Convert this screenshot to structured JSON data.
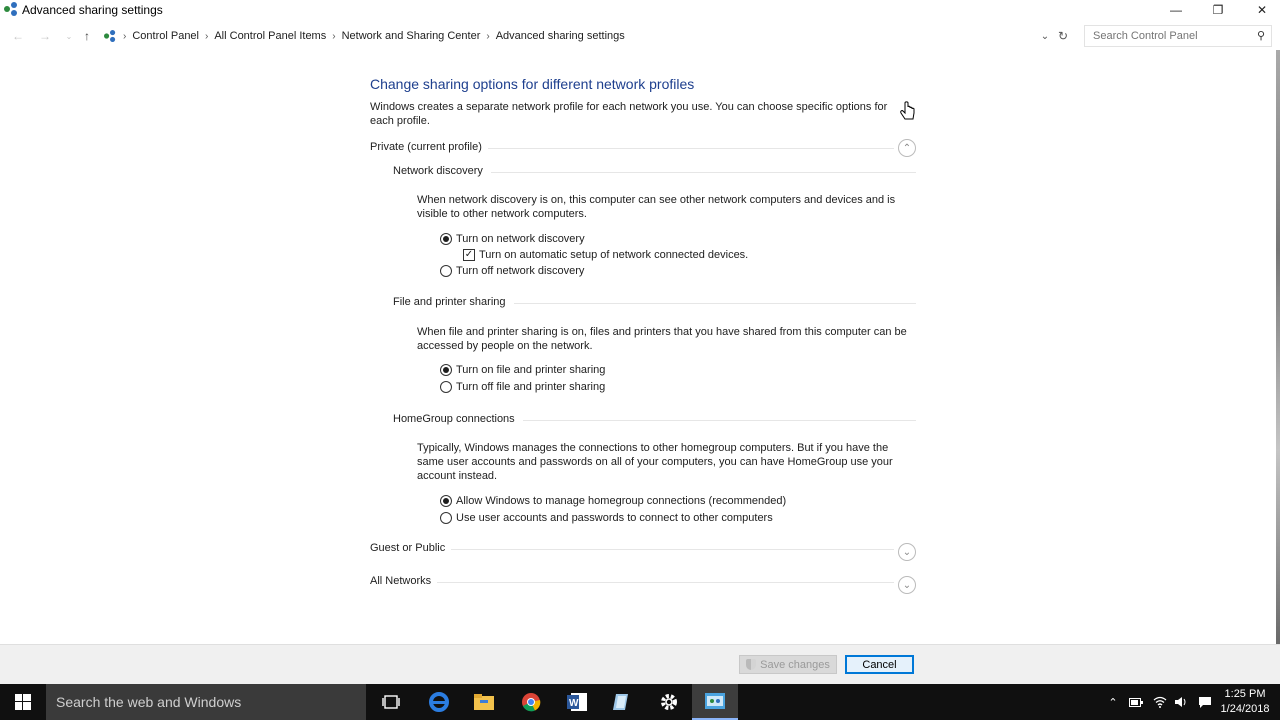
{
  "window": {
    "title": "Advanced sharing settings"
  },
  "address": {
    "crumbs": [
      "Control Panel",
      "All Control Panel Items",
      "Network and Sharing Center",
      "Advanced sharing settings"
    ],
    "search_placeholder": "Search Control Panel"
  },
  "page": {
    "heading": "Change sharing options for different network profiles",
    "intro": "Windows creates a separate network profile for each network you use. You can choose specific options for each profile.",
    "profiles": {
      "private": "Private (current profile)",
      "guest": "Guest or Public",
      "all": "All Networks"
    },
    "discovery": {
      "title": "Network discovery",
      "desc": "When network discovery is on, this computer can see other network computers and devices and is visible to other network computers.",
      "opt_on": "Turn on network discovery",
      "opt_auto": "Turn on automatic setup of network connected devices.",
      "opt_off": "Turn off network discovery"
    },
    "sharing": {
      "title": "File and printer sharing",
      "desc": "When file and printer sharing is on, files and printers that you have shared from this computer can be accessed by people on the network.",
      "opt_on": "Turn on file and printer sharing",
      "opt_off": "Turn off file and printer sharing"
    },
    "homegroup": {
      "title": "HomeGroup connections",
      "desc": "Typically, Windows manages the connections to other homegroup computers. But if you have the same user accounts and passwords on all of your computers, you can have HomeGroup use your account instead.",
      "opt_allow": "Allow Windows to manage homegroup connections (recommended)",
      "opt_user": "Use user accounts and passwords to connect to other computers"
    }
  },
  "footer": {
    "save": "Save changes",
    "cancel": "Cancel"
  },
  "taskbar": {
    "search": "Search the web and Windows",
    "time": "1:25 PM",
    "date": "1/24/2018"
  },
  "colors": {
    "heading": "#1e3f8e",
    "accent": "#0078d7",
    "taskbar": "#101010"
  }
}
